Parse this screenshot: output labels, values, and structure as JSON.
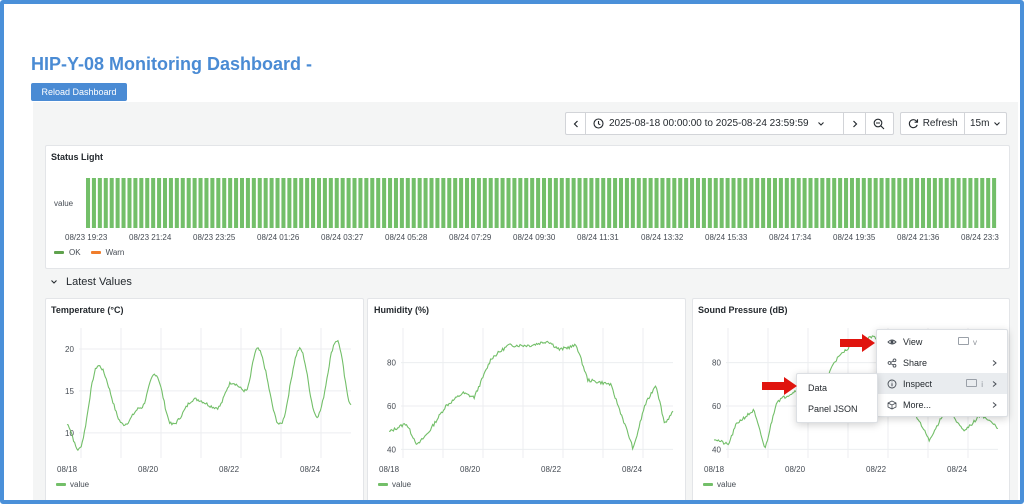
{
  "dashboard": {
    "title": "HIP-Y-08 Monitoring Dashboard -",
    "reload_label": "Reload Dashboard"
  },
  "toolbar": {
    "time_range": "2025-08-18 00:00:00 to 2025-08-24 23:59:59",
    "refresh_label": "Refresh",
    "interval": "15m"
  },
  "status_panel": {
    "title": "Status Light",
    "row_label": "value",
    "ticks": [
      "08/23 19:23",
      "08/23 21:24",
      "08/23 23:25",
      "08/24 01:26",
      "08/24 03:27",
      "08/24 05:28",
      "08/24 07:29",
      "08/24 09:30",
      "08/24 11:31",
      "08/24 13:32",
      "08/24 15:33",
      "08/24 17:34",
      "08/24 19:35",
      "08/24 21:36",
      "08/24 23:3"
    ],
    "legend": [
      {
        "label": "OK",
        "color": "#5fa24d"
      },
      {
        "label": "Warn",
        "color": "#f07d2c"
      }
    ],
    "bar_color": "#73bf69"
  },
  "row": {
    "title": "Latest Values"
  },
  "panels": [
    {
      "title": "Temperature (°C)",
      "yticks": [
        "20",
        "15",
        "10"
      ],
      "xticks": [
        "08/18",
        "08/20",
        "08/22",
        "08/24"
      ],
      "legend": "value"
    },
    {
      "title": "Humidity (%)",
      "yticks": [
        "80",
        "60",
        "40"
      ],
      "xticks": [
        "08/18",
        "08/20",
        "08/22",
        "08/24"
      ],
      "legend": "value"
    },
    {
      "title": "Sound Pressure (dB)",
      "yticks": [
        "80",
        "60",
        "40"
      ],
      "xticks": [
        "08/18",
        "08/20",
        "08/22",
        "08/24"
      ],
      "legend": "value"
    }
  ],
  "context_menu": {
    "items": [
      {
        "label": "View",
        "shortcut": "v"
      },
      {
        "label": "Share"
      },
      {
        "label": "Inspect",
        "shortcut": "i"
      },
      {
        "label": "More..."
      }
    ]
  },
  "submenu": {
    "items": [
      "Data",
      "Panel JSON"
    ]
  },
  "colors": {
    "accent": "#4a8bd4",
    "series": "#73bf69",
    "annotation_arrow": "#e0140e"
  }
}
